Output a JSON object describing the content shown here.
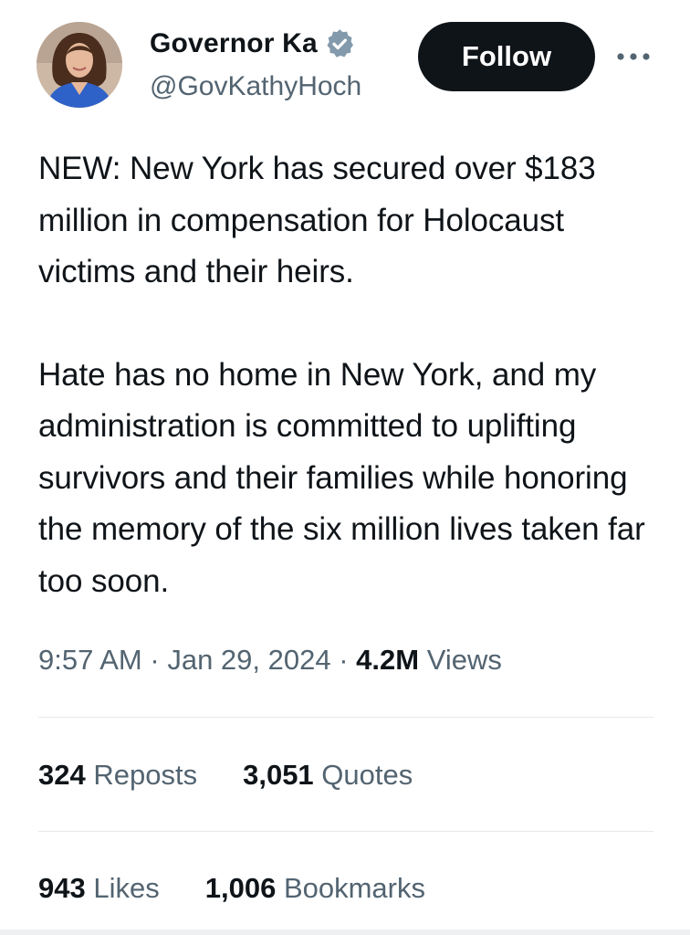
{
  "author": {
    "display_name": "Governor Ka",
    "handle": "@GovKathyHoch",
    "avatar": "avatar-photo",
    "verified_icon": "verified-badge-icon"
  },
  "header": {
    "follow_label": "Follow",
    "more_icon": "more-dots-icon"
  },
  "tweet": {
    "paragraph_1": "NEW: New York has secured over $183 million in compensation for Holocaust victims and their heirs.",
    "paragraph_2": "Hate has no home in New York, and my administration is committed to uplifting survivors and their families while honoring the memory of the six million lives taken far too soon."
  },
  "meta": {
    "time": "9:57 AM",
    "separator": "·",
    "date": "Jan 29, 2024",
    "views_count": "4.2M",
    "views_label": "Views"
  },
  "stats": {
    "reposts_count": "324",
    "reposts_label": "Reposts",
    "quotes_count": "3,051",
    "quotes_label": "Quotes",
    "likes_count": "943",
    "likes_label": "Likes",
    "bookmarks_count": "1,006",
    "bookmarks_label": "Bookmarks"
  },
  "colors": {
    "text": "#0f1419",
    "secondary": "#536471",
    "button": "#0f1419",
    "verified_badge": "#829aab",
    "divider": "#e6e9ec"
  }
}
